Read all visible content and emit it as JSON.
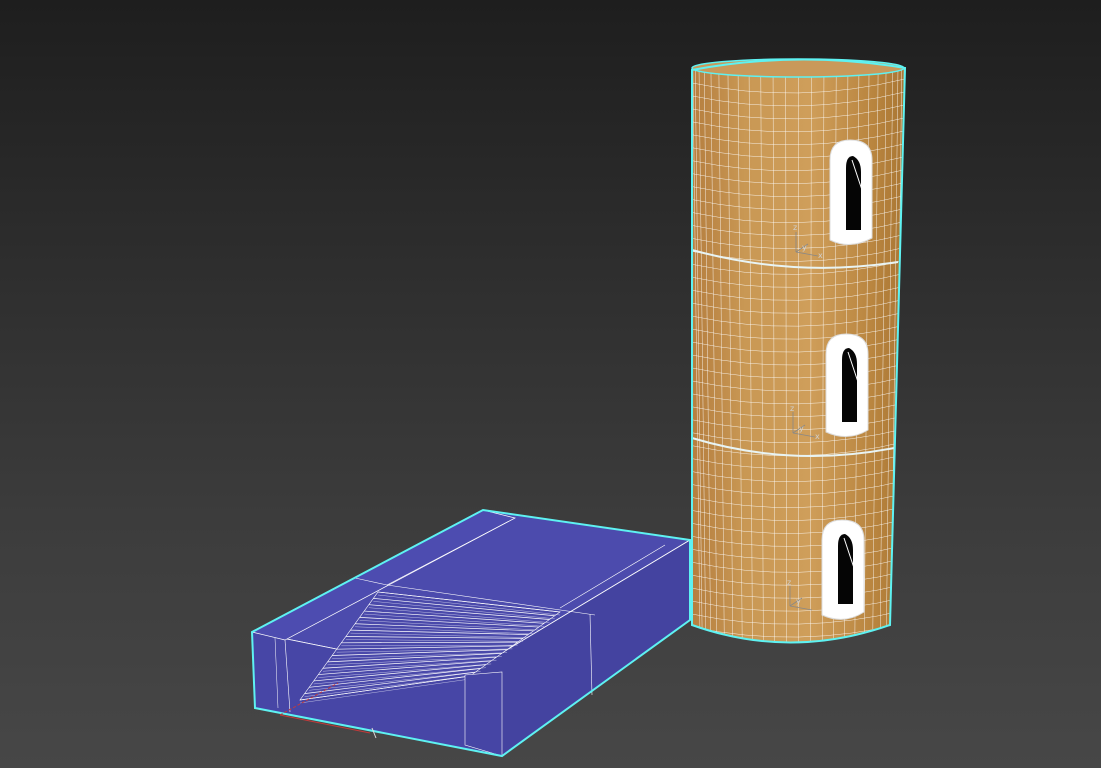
{
  "viewport": {
    "mode": "perspective",
    "background": "#3a3a3a"
  },
  "objects": [
    {
      "name": "stairs-block",
      "type": "editable-mesh",
      "color": "#4b4aac",
      "wire_color": "#ffffff",
      "selected": true,
      "step_count": 18
    },
    {
      "name": "tower",
      "type": "editable-mesh",
      "color": "#c49251",
      "wire_color": "#ffffff",
      "selected": true,
      "segments": 3,
      "windows": 3
    }
  ],
  "selection_color": "#5ef2f2",
  "gizmo_labels": {
    "z": "z",
    "y": "y",
    "x": "x"
  }
}
